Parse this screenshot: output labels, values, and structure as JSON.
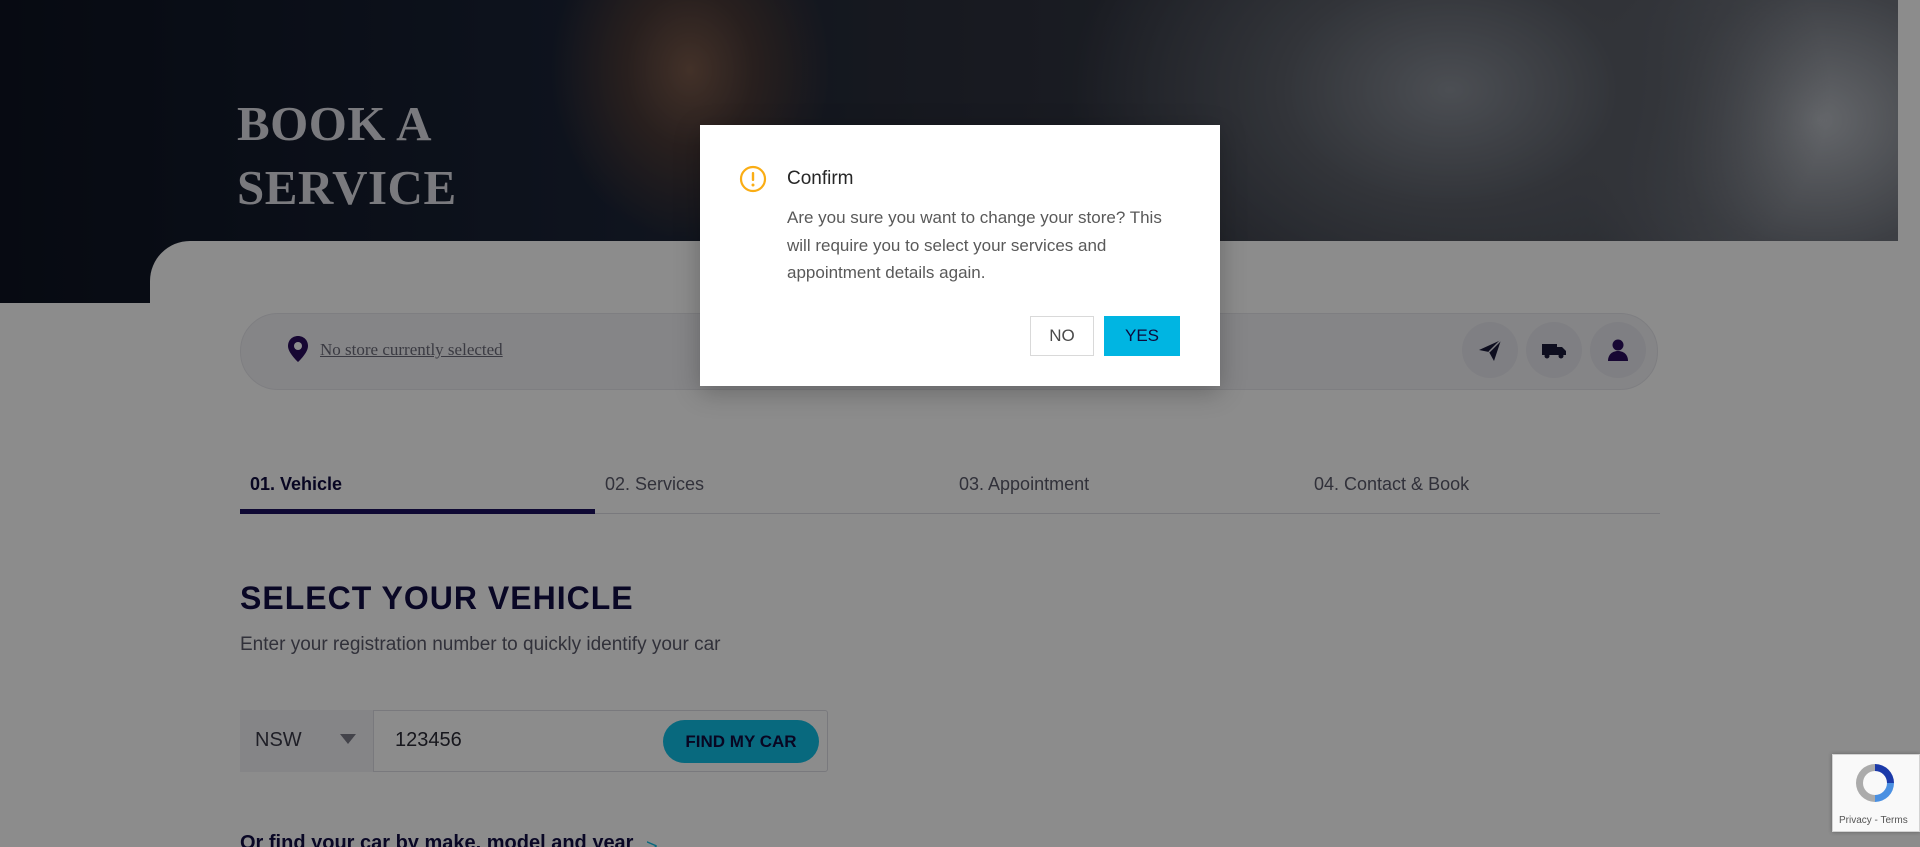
{
  "hero": {
    "title_line1": "BOOK A",
    "title_line2": "SERVICE"
  },
  "store_bar": {
    "store_text": "No store currently selected",
    "icons": [
      "send-icon",
      "truck-icon",
      "user-icon"
    ]
  },
  "tabs": [
    {
      "label": "01. Vehicle",
      "active": true
    },
    {
      "label": "02. Services",
      "active": false
    },
    {
      "label": "03. Appointment",
      "active": false
    },
    {
      "label": "04. Contact & Book",
      "active": false
    }
  ],
  "vehicle": {
    "title": "SELECT YOUR VEHICLE",
    "subtitle": "Enter your registration number to quickly identify your car",
    "state": "NSW",
    "rego_value": "123456",
    "find_button": "FIND MY CAR",
    "make_link": "Or find your car by make, model and year",
    "make_link_chevron": ">"
  },
  "modal": {
    "title": "Confirm",
    "body": "Are you sure you want to change your store? This will require you to select your services and appointment details again.",
    "no_label": "NO",
    "yes_label": "YES"
  },
  "recaptcha": {
    "text": "Privacy - Terms"
  },
  "colors": {
    "accent": "#10bfe6",
    "brand_dark": "#120d44",
    "warning": "#faad14"
  }
}
